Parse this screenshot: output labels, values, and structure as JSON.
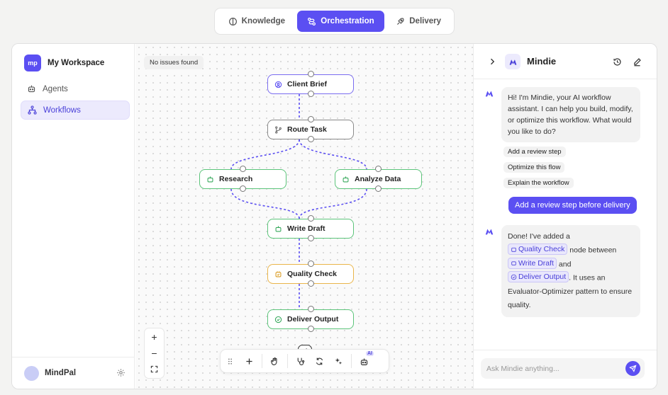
{
  "tabs": [
    {
      "label": "Knowledge",
      "icon": "book-icon"
    },
    {
      "label": "Orchestration",
      "icon": "workflow-icon",
      "active": true
    },
    {
      "label": "Delivery",
      "icon": "rocket-icon"
    }
  ],
  "sidebar": {
    "workspace_logo": "mp",
    "workspace_name": "My Workspace",
    "items": [
      {
        "label": "Agents",
        "icon": "robot-icon"
      },
      {
        "label": "Workflows",
        "icon": "sitemap-icon",
        "active": true
      }
    ],
    "user_name": "MindPal"
  },
  "canvas": {
    "status": "No issues found",
    "nodes": {
      "client_brief": "Client Brief",
      "route_task": "Route Task",
      "research": "Research",
      "analyze_data": "Analyze Data",
      "write_draft": "Write Draft",
      "quality_check": "Quality Check",
      "deliver_output": "Deliver Output"
    },
    "zoom_in": "+",
    "zoom_out": "−",
    "ai_badge": "AI"
  },
  "chat": {
    "title": "Mindie",
    "greeting": "Hi! I'm Mindie, your AI workflow assistant. I can help you build, modify, or optimize this workflow. What would you like to do?",
    "suggestions": [
      "Add a review step",
      "Optimize this flow",
      "Explain the workflow"
    ],
    "user_message": "Add a review step before delivery",
    "reply": {
      "prefix": "Done! I've added a",
      "tag1": "Quality Check",
      "mid1": "node between",
      "tag2": "Write Draft",
      "mid2": "and",
      "tag3": "Deliver Output",
      "suffix": ". It uses an Evaluator-Optimizer pattern to ensure quality."
    },
    "input_placeholder": "Ask Mindie anything..."
  },
  "colors": {
    "accent": "#5b4ff2",
    "node_purple": "#7a6cf0",
    "node_green": "#5cc47a",
    "node_orange": "#eab54a",
    "edge": "#5b4ff2"
  }
}
